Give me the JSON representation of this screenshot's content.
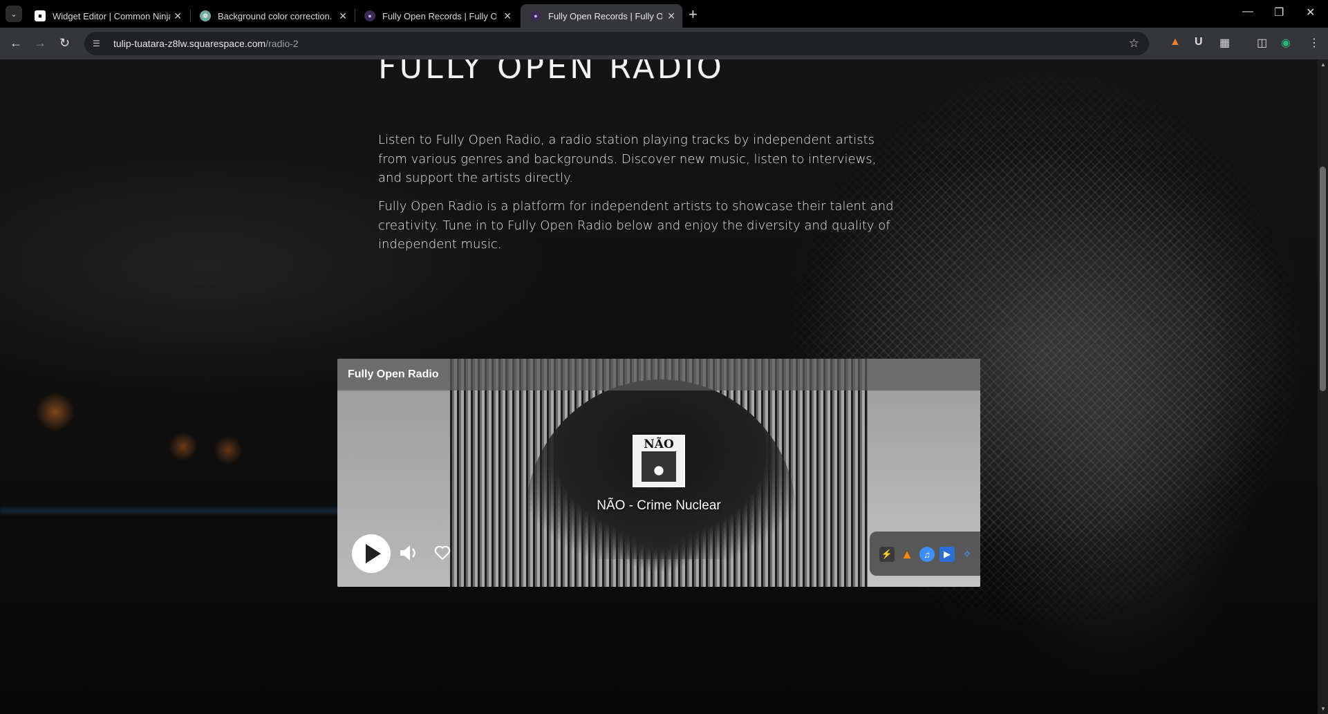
{
  "browser": {
    "tabs": [
      {
        "title": "Widget Editor | Common Ninja",
        "active": false,
        "icon": "common-ninja-icon"
      },
      {
        "title": "Background color correction.",
        "active": false,
        "icon": "chatgpt-icon"
      },
      {
        "title": "Fully Open Records | Fully Open",
        "active": false,
        "icon": "squarespace-icon"
      },
      {
        "title": "Fully Open Records | Fully Open",
        "active": true,
        "icon": "squarespace-icon"
      }
    ],
    "url_domain": "tulip-tuatara-z8lw.squarespace.com",
    "url_path": "/radio-2"
  },
  "page": {
    "heading": "FULLY OPEN RADIO",
    "paragraph1": "Listen to Fully Open Radio, a radio station playing tracks by independent artists from various genres and backgrounds. Discover new music, listen to interviews, and support the artists directly.",
    "paragraph2": "Fully Open Radio is a platform for independent artists to showcase their talent and creativity. Tune in to Fully Open Radio below and enjoy the diversity and quality of independent music."
  },
  "player": {
    "station_name": "Fully Open Radio",
    "now_playing": "NÃO - Crime Nuclear",
    "cover_text": "NÃO",
    "app_icons": [
      "winamp-icon",
      "vlc-icon",
      "itunes-icon",
      "media-player-icon",
      "realplayer-icon"
    ]
  },
  "colors": {
    "browser_bg": "#000000",
    "toolbar_bg": "#35363a",
    "page_bg": "#0e0e0e",
    "text": "#e6e6e6"
  }
}
